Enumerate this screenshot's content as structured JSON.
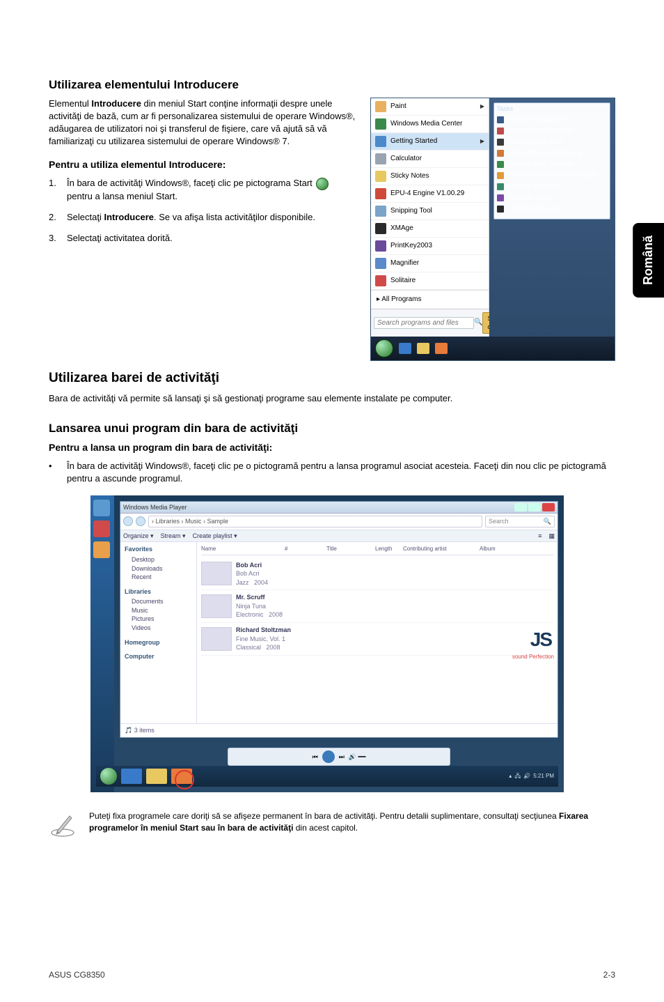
{
  "side_tab": "Română",
  "section1": {
    "title": "Utilizarea elementului Introducere",
    "para": "Elementul <b>Introducere</b> din meniul Start conţine informaţii despre unele activităţi de bază, cum ar fi personalizarea sistemului de operare Windows®, adăugarea de utilizatori noi şi transferul de fişiere, care vă ajută să vă familiarizaţi cu utilizarea sistemului de operare Windows® 7.",
    "sub": "Pentru a utiliza elementul Introducere:",
    "steps": [
      {
        "num": "1.",
        "text_a": "În bara de activităţi Windows®, faceţi clic pe pictograma Start ",
        "text_b": " pentru a lansa meniul Start."
      },
      {
        "num": "2.",
        "text_a": "Selectaţi ",
        "bold": "Introducere",
        "text_b": ". Se va afişa lista activităţilor disponibile."
      },
      {
        "num": "3.",
        "text_a": "Selectaţi activitatea dorită."
      }
    ]
  },
  "startmenu": {
    "items": [
      {
        "label": "Paint",
        "ico": "#e8b060",
        "arrow": true
      },
      {
        "label": "Windows Media Center",
        "ico": "#3a8a4a"
      },
      {
        "label": "Getting Started",
        "ico": "#4a8aca",
        "hl": true,
        "arrow": true
      },
      {
        "label": "Calculator",
        "ico": "#9aa4b0"
      },
      {
        "label": "Sticky Notes",
        "ico": "#e8c860"
      },
      {
        "label": "EPU-4 Engine V1.00.29",
        "ico": "#d04a3a"
      },
      {
        "label": "Snipping Tool",
        "ico": "#7aa4c8"
      },
      {
        "label": "XMAge",
        "ico": "#2a2a2a"
      },
      {
        "label": "PrintKey2003",
        "ico": "#6a4a9a"
      },
      {
        "label": "Magnifier",
        "ico": "#5a8aca"
      },
      {
        "label": "Solitaire",
        "ico": "#d04a4a"
      }
    ],
    "all_programs": "All Programs",
    "search_placeholder": "Search programs and files",
    "shutdown": "Shut down",
    "tasks_title": "Tasks",
    "tasks": [
      {
        "label": "Discover Windows 7",
        "ico": "#3a5a8a"
      },
      {
        "label": "Personalize Windows",
        "ico": "#c04a4a"
      },
      {
        "label": "Transfer your files",
        "ico": "#3a3a3a"
      },
      {
        "label": "Share with a homegroup",
        "ico": "#d07a3a"
      },
      {
        "label": "Change UAC settings",
        "ico": "#3a8a4a"
      },
      {
        "label": "Get Windows Live Essentials",
        "ico": "#e09a3a"
      },
      {
        "label": "Back up your files",
        "ico": "#3a8a6a"
      },
      {
        "label": "Add new users",
        "ico": "#7a4aaa"
      },
      {
        "label": "Change text size",
        "ico": "#2a2a2a"
      }
    ]
  },
  "section2": {
    "title": "Utilizarea barei de activităţi",
    "para": "Bara de activităţi vă permite să lansaţi şi să gestionaţi programe sau elemente instalate pe computer."
  },
  "section3": {
    "title": "Lansarea unui program din bara de activităţi",
    "sub": "Pentru a lansa un program din bara de activităţi:",
    "bullet": "În bara de activităţi Windows®, faceţi clic pe o pictogramă pentru a lansa programul asociat acesteia. Faceţi din nou clic pe pictogramă pentru a ascunde programul."
  },
  "explorer": {
    "title": "Windows Media Player",
    "path": "› Libraries › Music › Sample",
    "search": "Search",
    "toolbar": [
      "Organize ▾",
      "Stream ▾",
      "Create playlist ▾"
    ],
    "view_icons": [
      "≡",
      "▦"
    ],
    "nav": {
      "favorites": {
        "hd": "Favorites",
        "items": [
          "Desktop",
          "Downloads",
          "Recent"
        ]
      },
      "libraries": {
        "hd": "Libraries",
        "items": [
          "Documents",
          "Music",
          "Pictures",
          "Videos"
        ]
      },
      "homegroup": {
        "hd": "Homegroup"
      },
      "computer": {
        "hd": "Computer"
      }
    },
    "cols": [
      "Name",
      "#",
      "Title",
      "Length",
      "Contributing artist",
      "Album"
    ],
    "rows": [
      {
        "album": "Bob Acri",
        "artist": "Bob Acri",
        "genre": "Jazz",
        "year": "2004"
      },
      {
        "album": "Mr. Scruff",
        "artist": "Ninja Tuna",
        "genre": "Electronic",
        "year": "2008"
      },
      {
        "album": "Richard Stoltzman",
        "artist": "Fine Music, Vol. 1",
        "genre": "Classical",
        "year": "2008"
      }
    ],
    "status": "3 items",
    "brand": "JS",
    "brand_tag": "sound Perfection",
    "tray_time": "5:21 PM"
  },
  "note": {
    "text_a": "Puteţi fixa programele care doriţi să se afişeze permanent în bara de activităţi. Pentru detalii suplimentare, consultaţi secţiunea ",
    "bold": "Fixarea programelor în meniul Start sau în bara de activităţi",
    "text_b": " din acest capitol."
  },
  "footer": {
    "left": "ASUS CG8350",
    "right": "2-3"
  }
}
